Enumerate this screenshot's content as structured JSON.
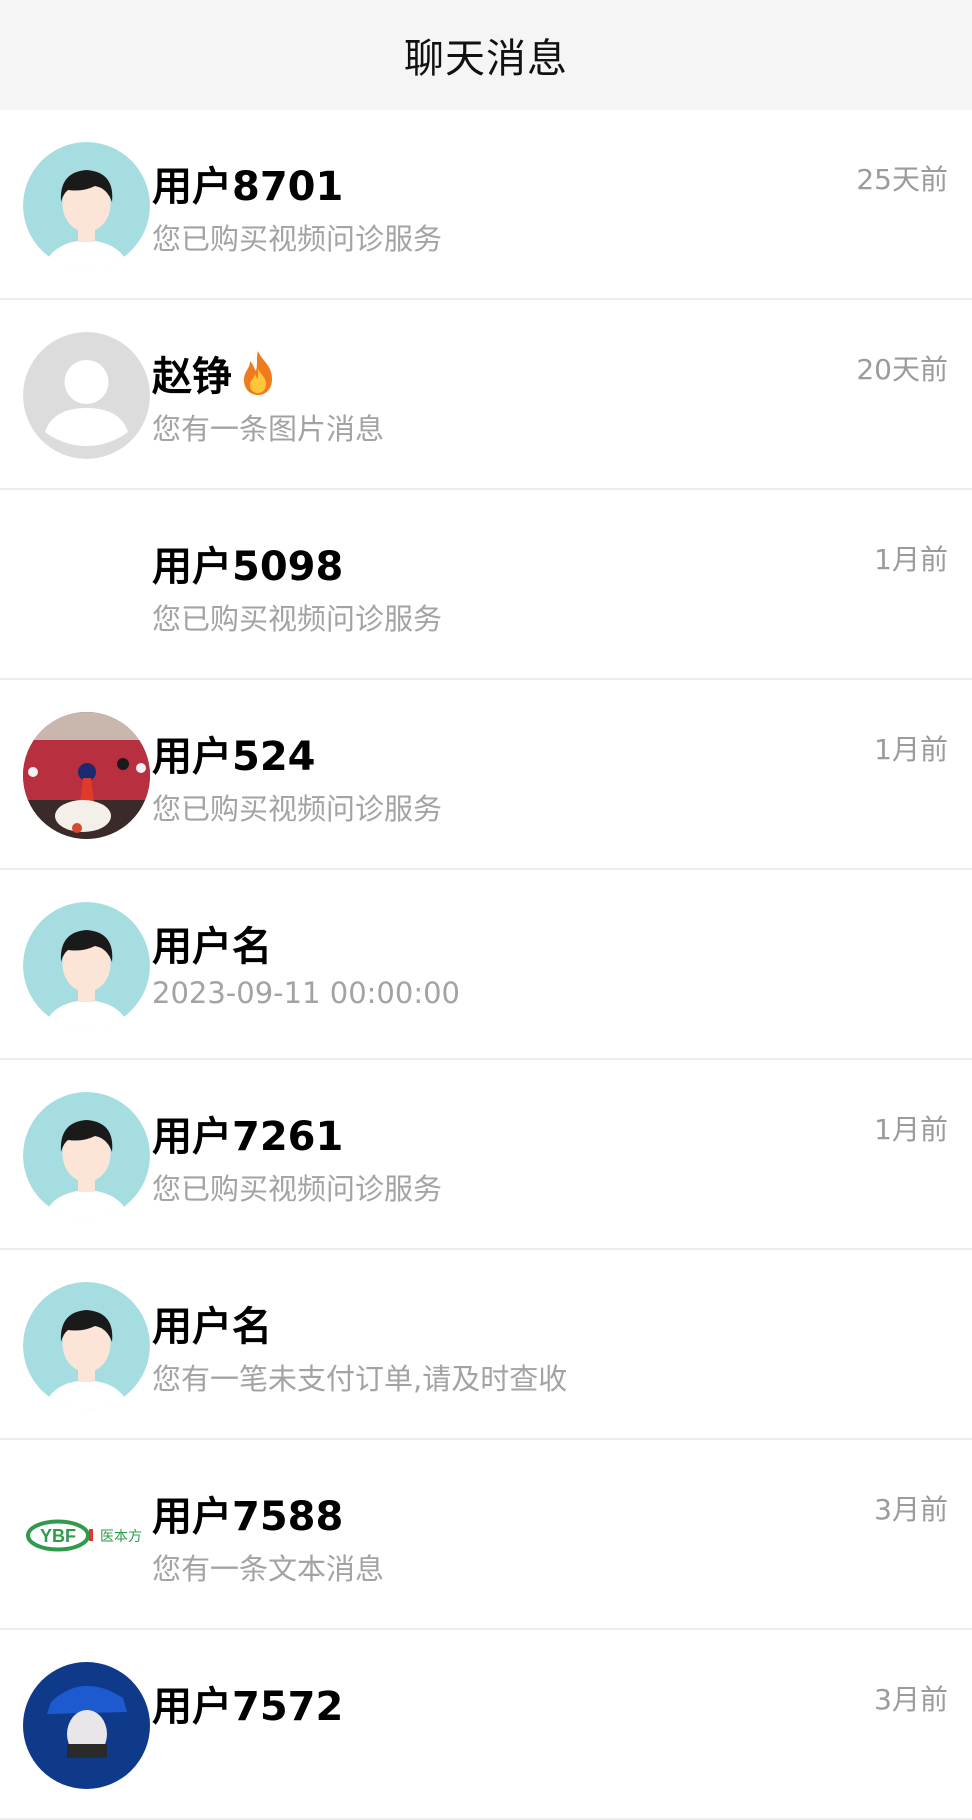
{
  "header": {
    "title": "聊天消息"
  },
  "chats": [
    {
      "name": "用户8701",
      "preview": "您已购买视频问诊服务",
      "time": "25天前",
      "avatar": "default-person-icon"
    },
    {
      "name": "赵铮",
      "badge": "fire-icon",
      "preview": "您有一条图片消息",
      "time": "20天前",
      "avatar": "placeholder-gray-icon"
    },
    {
      "name": "用户5098",
      "preview": "您已购买视频问诊服务",
      "time": "1月前",
      "avatar": "blank"
    },
    {
      "name": "用户524",
      "preview": "您已购买视频问诊服务",
      "time": "1月前",
      "avatar": "photo-gallery"
    },
    {
      "name": "用户名",
      "preview": "2023-09-11 00:00:00",
      "time": "",
      "avatar": "default-person-icon"
    },
    {
      "name": "用户7261",
      "preview": "您已购买视频问诊服务",
      "time": "1月前",
      "avatar": "default-person-icon"
    },
    {
      "name": "用户名",
      "preview": "您有一笔未支付订单,请及时查收",
      "time": "",
      "avatar": "default-person-icon"
    },
    {
      "name": "用户7588",
      "preview": "您有一条文本消息",
      "time": "3月前",
      "avatar": "ybf-logo",
      "logo_text": "YBF",
      "logo_sub": "医本方"
    },
    {
      "name": "用户7572",
      "preview": "",
      "time": "3月前",
      "avatar": "photo-blue-cap"
    }
  ],
  "colors": {
    "header_bg": "#f5f5f5",
    "avatar_teal": "#a6dde0",
    "logo_green": "#2e9a4a",
    "secondary_text": "#a3a3a3"
  }
}
